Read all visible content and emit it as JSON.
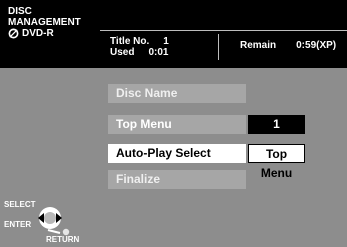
{
  "header": {
    "title_line1": "DISC",
    "title_line2": "MANAGEMENT",
    "disc_type": "DVD-R",
    "title_no_label": "Title No.",
    "title_no_value": "1",
    "used_label": "Used",
    "used_value": "0:01",
    "remain_label": "Remain",
    "remain_value": "0:59(XP)"
  },
  "menu": {
    "items": [
      {
        "label": "Disc Name",
        "state": "disabled"
      },
      {
        "label": "Top Menu",
        "value": "1",
        "state": "normal"
      },
      {
        "label": "Auto-Play Select",
        "value": "Top Menu",
        "state": "selected"
      },
      {
        "label": "Finalize",
        "state": "disabled"
      }
    ]
  },
  "nav": {
    "select_label": "SELECT",
    "enter_label": "ENTER",
    "return_label": "RETURN"
  },
  "colors": {
    "background": "#8d8d8d",
    "header": "#000000",
    "item_bg": "#a6a6a6",
    "selected_bg": "#ffffff"
  }
}
